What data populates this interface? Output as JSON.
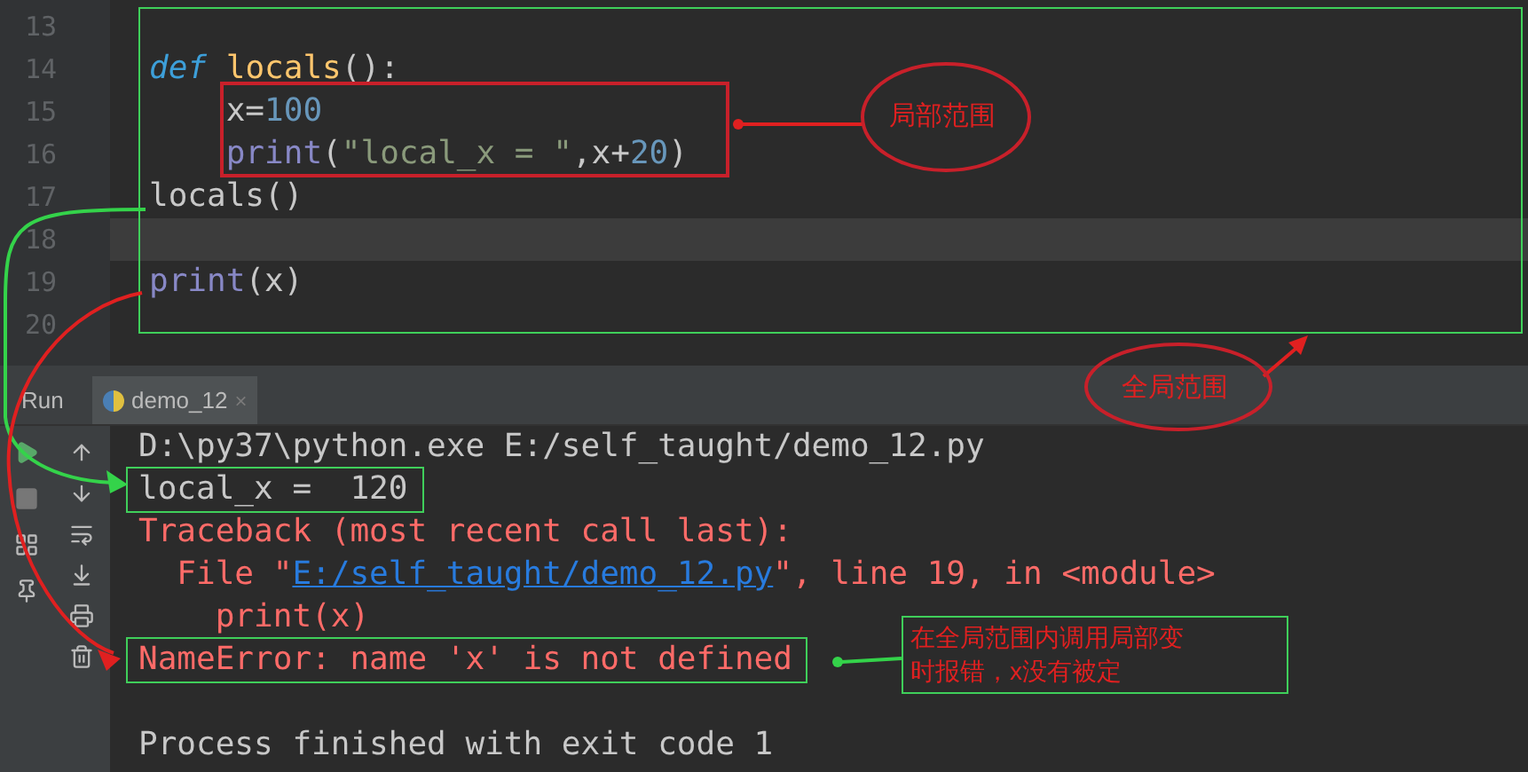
{
  "editor": {
    "lines": [
      {
        "number": "13",
        "current": false
      },
      {
        "number": "14",
        "current": false,
        "tokens": [
          {
            "kind": "keyword",
            "text": "def "
          },
          {
            "kind": "function",
            "text": "locals"
          },
          {
            "kind": "plain",
            "text": "():"
          }
        ]
      },
      {
        "number": "15",
        "current": false,
        "tokens": [
          {
            "kind": "plain",
            "text": "    x="
          },
          {
            "kind": "number",
            "text": "100"
          }
        ]
      },
      {
        "number": "16",
        "current": false,
        "tokens": [
          {
            "kind": "builtin",
            "text": "    print"
          },
          {
            "kind": "plain",
            "text": "("
          },
          {
            "kind": "string",
            "text": "\"local_x = \""
          },
          {
            "kind": "plain",
            "text": ",x+"
          },
          {
            "kind": "number",
            "text": "20"
          },
          {
            "kind": "plain",
            "text": ")"
          }
        ]
      },
      {
        "number": "17",
        "current": false,
        "tokens": [
          {
            "kind": "plain",
            "text": "locals()"
          }
        ]
      },
      {
        "number": "18",
        "current": true
      },
      {
        "number": "19",
        "current": false,
        "tokens": [
          {
            "kind": "builtin",
            "text": "print"
          },
          {
            "kind": "plain",
            "text": "(x)"
          }
        ]
      },
      {
        "number": "20",
        "current": false
      }
    ]
  },
  "run_panel": {
    "label": "Run",
    "tab": {
      "title": "demo_12",
      "close": "×",
      "selected": true
    },
    "console": [
      {
        "kind": "output",
        "framed": false,
        "tokens": [
          {
            "kind": "plain",
            "text": "D:\\py37\\python.exe E:/self_taught/demo_12.py"
          }
        ]
      },
      {
        "kind": "output",
        "framed": true,
        "tokens": [
          {
            "kind": "plain",
            "text": "local_x =  120"
          }
        ]
      },
      {
        "kind": "output",
        "framed": false,
        "tokens": [
          {
            "kind": "error",
            "text": "Traceback (most recent call last):"
          }
        ]
      },
      {
        "kind": "output",
        "framed": false,
        "tokens": [
          {
            "kind": "error",
            "text": "  File \""
          },
          {
            "kind": "link",
            "text": "E:/self_taught/demo_12.py"
          },
          {
            "kind": "error",
            "text": "\", line 19, in <module>"
          }
        ]
      },
      {
        "kind": "output",
        "framed": false,
        "tokens": [
          {
            "kind": "error",
            "text": "    print(x)"
          }
        ]
      },
      {
        "kind": "output",
        "framed": true,
        "tokens": [
          {
            "kind": "error",
            "text": "NameError: name 'x' is not defined"
          }
        ]
      },
      {
        "kind": "blank"
      },
      {
        "kind": "output",
        "framed": false,
        "tokens": [
          {
            "kind": "plain",
            "text": "Process finished with exit code 1"
          }
        ]
      }
    ]
  },
  "annotations": {
    "local_scope": "局部范围",
    "global_scope": "全局范围",
    "callout": [
      "在全局范围内调用局部变",
      "时报错，x没有被定"
    ]
  }
}
